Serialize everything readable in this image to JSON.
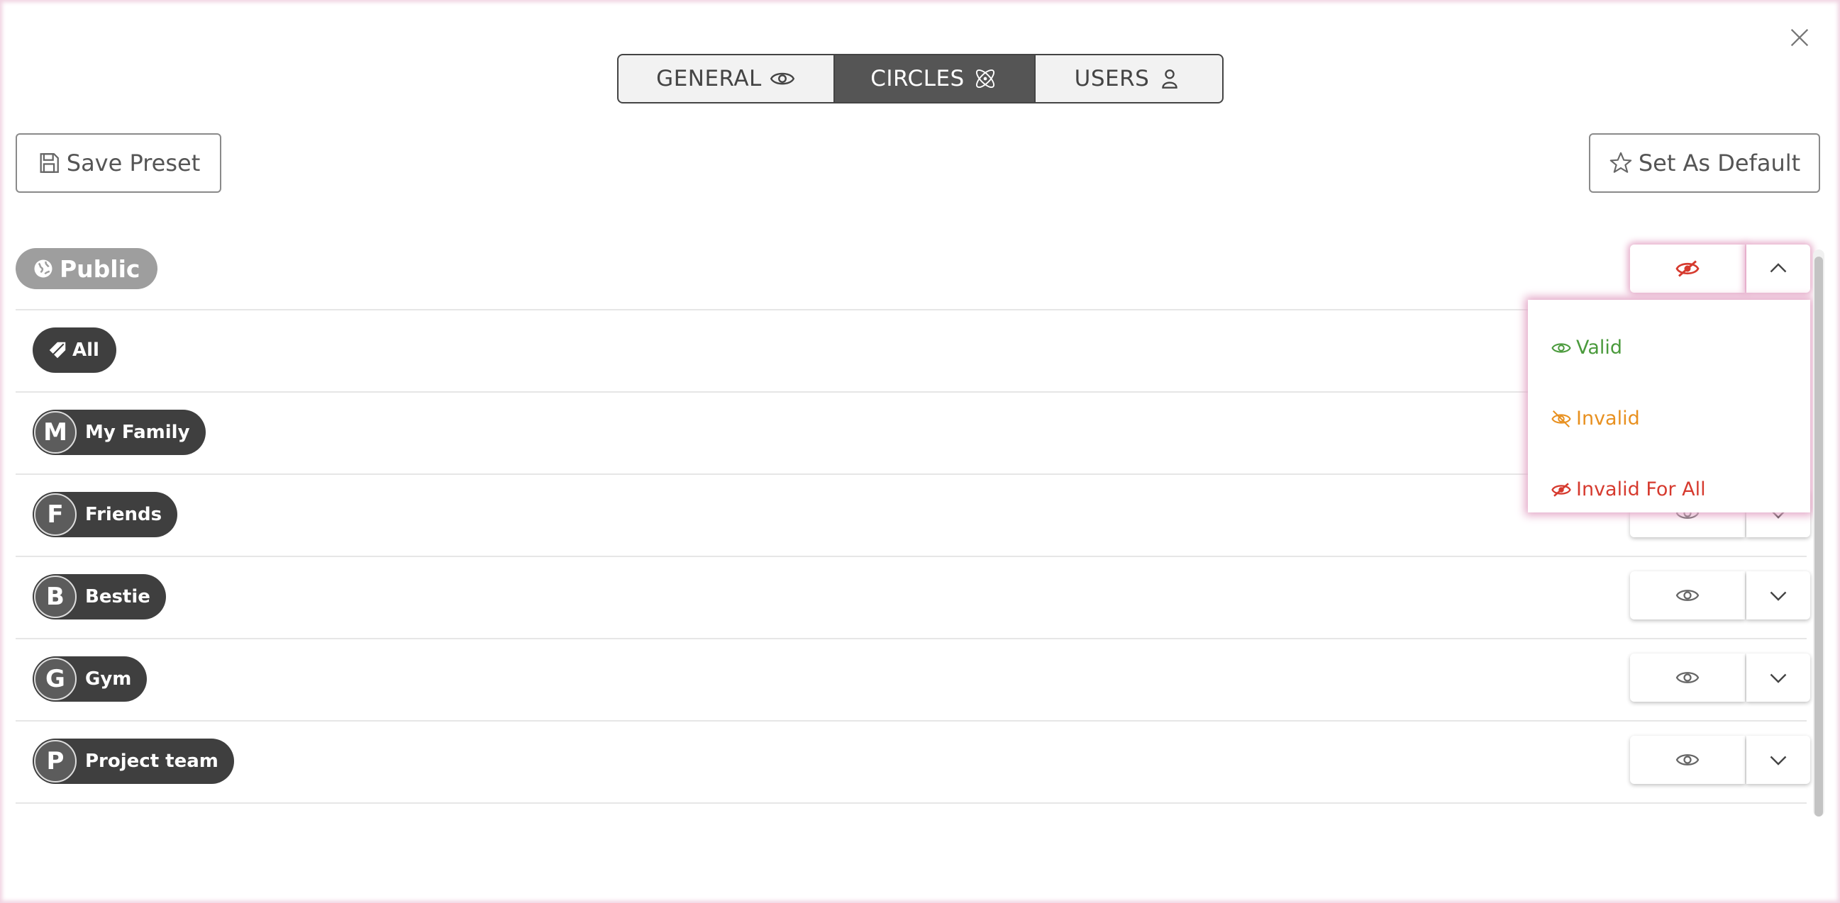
{
  "tabs": [
    {
      "label": "GENERAL",
      "icon": "eye-icon",
      "active": false
    },
    {
      "label": "CIRCLES",
      "icon": "atom-icon",
      "active": true
    },
    {
      "label": "USERS",
      "icon": "user-icon",
      "active": false
    }
  ],
  "toolbar": {
    "save_preset_label": "Save Preset",
    "set_default_label": "Set As Default"
  },
  "public": {
    "label": "Public",
    "status": "Invalid For All"
  },
  "circles": [
    {
      "initial": "",
      "label": "All"
    },
    {
      "initial": "M",
      "label": "My Family"
    },
    {
      "initial": "F",
      "label": "Friends"
    },
    {
      "initial": "B",
      "label": "Bestie"
    },
    {
      "initial": "G",
      "label": "Gym"
    },
    {
      "initial": "P",
      "label": "Project team"
    }
  ],
  "dropdown": {
    "options": [
      {
        "label": "Valid",
        "color": "#4a9a3c",
        "icon": "eye-icon"
      },
      {
        "label": "Invalid",
        "color": "#e8901f",
        "icon": "eye-off-icon"
      },
      {
        "label": "Invalid For All",
        "color": "#d63a2e",
        "icon": "eye-crossed-fill-icon"
      }
    ]
  },
  "colors": {
    "accent_dark": "#555555",
    "valid": "#4a9a3c",
    "invalid": "#e8901f",
    "invalid_all": "#d63a2e"
  }
}
